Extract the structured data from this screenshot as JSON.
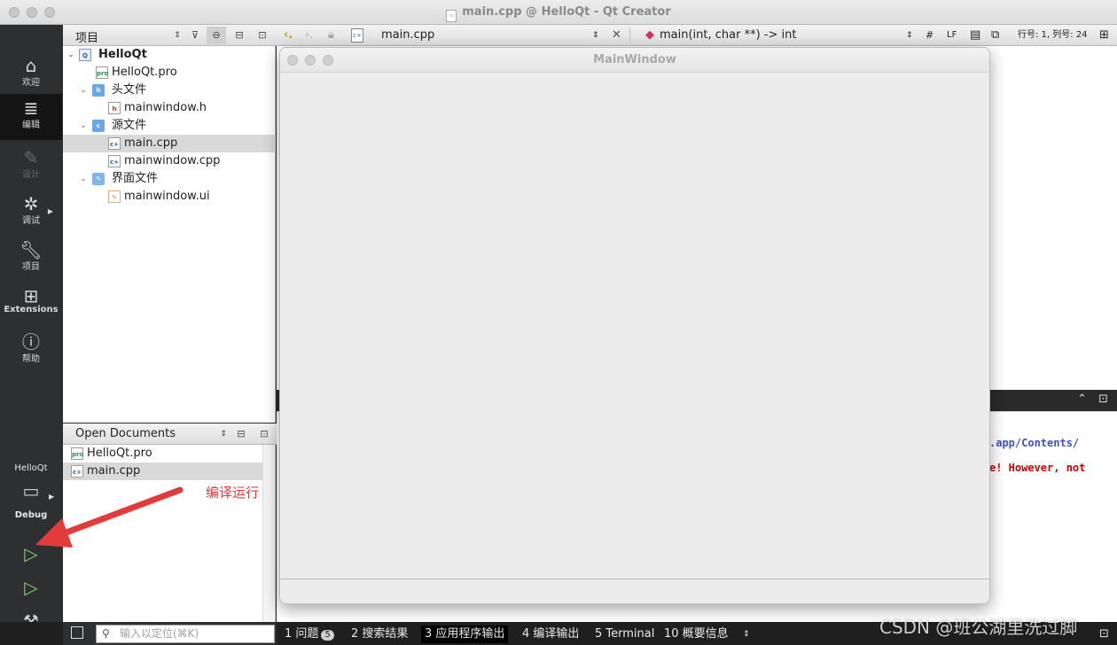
{
  "window": {
    "title": "main.cpp @ HelloQt - Qt Creator"
  },
  "modebar": {
    "modes": [
      {
        "label": "欢迎",
        "icon": "home-icon"
      },
      {
        "label": "编辑",
        "icon": "edit-lines-icon"
      },
      {
        "label": "设计",
        "icon": "design-pen-icon"
      },
      {
        "label": "调试",
        "icon": "bug-icon"
      },
      {
        "label": "项目",
        "icon": "wrench-icon"
      },
      {
        "label": "Extensions",
        "icon": "extensions-icon"
      },
      {
        "label": "帮助",
        "icon": "help-icon"
      }
    ],
    "kit": {
      "project": "HelloQt",
      "config": "Debug"
    }
  },
  "project_panel": {
    "title": "项目",
    "tree": [
      {
        "label": "HelloQt",
        "level": 0,
        "expanded": true,
        "kind": "project"
      },
      {
        "label": "HelloQt.pro",
        "level": 1,
        "kind": "pro"
      },
      {
        "label": "头文件",
        "level": 1,
        "expanded": true,
        "kind": "folder"
      },
      {
        "label": "mainwindow.h",
        "level": 2,
        "kind": "header"
      },
      {
        "label": "源文件",
        "level": 1,
        "expanded": true,
        "kind": "folder"
      },
      {
        "label": "main.cpp",
        "level": 2,
        "kind": "source",
        "selected": true
      },
      {
        "label": "mainwindow.cpp",
        "level": 2,
        "kind": "source"
      },
      {
        "label": "界面文件",
        "level": 1,
        "expanded": true,
        "kind": "folder"
      },
      {
        "label": "mainwindow.ui",
        "level": 2,
        "kind": "ui"
      }
    ]
  },
  "open_documents": {
    "title": "Open Documents",
    "items": [
      {
        "label": "HelloQt.pro",
        "selected": false
      },
      {
        "label": "main.cpp",
        "selected": true
      }
    ]
  },
  "editor_toolbar": {
    "file": "main.cpp",
    "symbol": "main(int, char **) -> int",
    "hash": "#",
    "line_ending": "LF",
    "position": "行号: 1, 列号: 24"
  },
  "main_window": {
    "title": "MainWindow"
  },
  "output": {
    "lines": [
      {
        "text": ".app/Contents/",
        "color": "#3b4fd8"
      },
      {
        "text": "e! However, not",
        "color": "#d00000"
      }
    ]
  },
  "annotation": {
    "text": "编译运行",
    "color": "#e33b3b"
  },
  "statusbar": {
    "locator_placeholder": "输入以定位(⌘K)",
    "tabs": [
      {
        "label": "1 问题",
        "badge": "5"
      },
      {
        "label": "2 搜索结果"
      },
      {
        "label": "3 应用程序输出",
        "active": true
      },
      {
        "label": "4 编译输出"
      },
      {
        "label": "5 Terminal"
      },
      {
        "label": "10 概要信息"
      }
    ]
  },
  "watermark": "CSDN @班公湖里洗过脚"
}
